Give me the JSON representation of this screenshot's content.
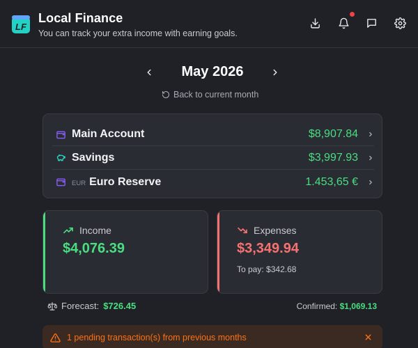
{
  "header": {
    "logo_text": "LF",
    "title": "Local Finance",
    "subtitle": "You can track your extra income with earning goals.",
    "icons": [
      "download-icon",
      "bell-icon",
      "chat-icon",
      "gear-icon"
    ]
  },
  "month": {
    "label": "May 2026",
    "back_label": "Back to current month"
  },
  "accounts": [
    {
      "name": "Main Account",
      "prefix": "",
      "amount": "$8,907.84",
      "icon": "wallet-icon"
    },
    {
      "name": "Savings",
      "prefix": "",
      "amount": "$3,997.93",
      "icon": "piggy-bank-icon"
    },
    {
      "name": "Euro Reserve",
      "prefix": "EUR",
      "amount": "1.453,65 €",
      "icon": "wallet-icon"
    }
  ],
  "income": {
    "label": "Income",
    "amount": "$4,076.39"
  },
  "expenses": {
    "label": "Expenses",
    "amount": "$3,349.94",
    "to_pay_label": "To pay:",
    "to_pay_value": "$342.68"
  },
  "forecast": {
    "label": "Forecast:",
    "value": "$726.45"
  },
  "confirmed": {
    "label": "Confirmed:",
    "value": "$1,069.13"
  },
  "pending": {
    "text": "1 pending transaction(s) from previous months"
  },
  "colors": {
    "background": "#1f2127",
    "card": "#2a2c34",
    "positive": "#4ade80",
    "negative": "#f87171",
    "accent_purple": "#8b5cf6",
    "warning": "#f97316",
    "logo_teal": "#22d3c5"
  }
}
